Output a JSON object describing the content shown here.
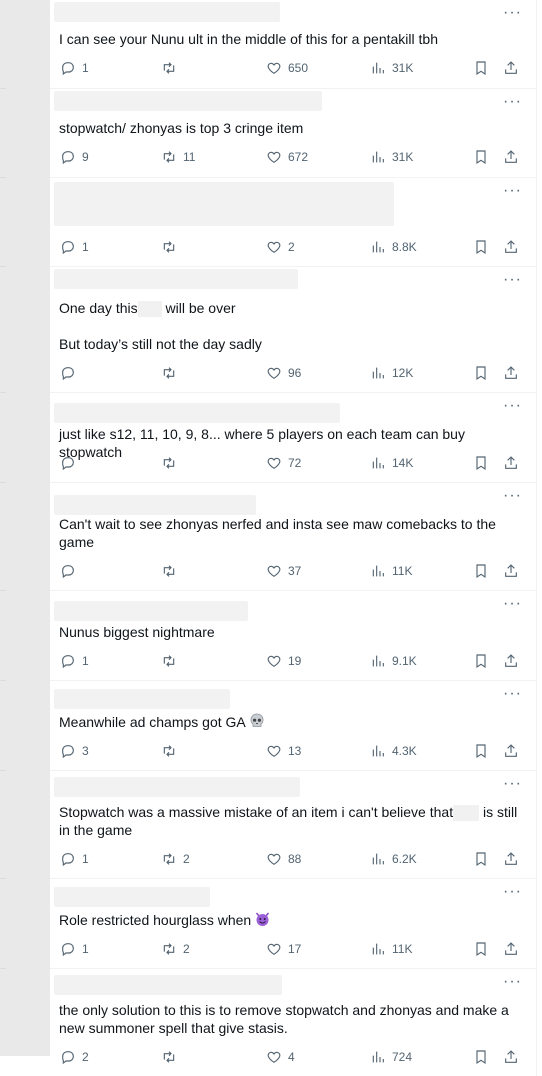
{
  "tweets": [
    {
      "text": "I can see your Nunu ult in the middle of this for a pentakill tbh",
      "replies": "1",
      "retweets": "",
      "likes": "650",
      "views": "31K"
    },
    {
      "text": "stopwatch/ zhonyas is top 3 cringe item",
      "replies": "9",
      "retweets": "11",
      "likes": "672",
      "views": "31K"
    },
    {
      "text": "",
      "replies": "1",
      "retweets": "",
      "likes": "2",
      "views": "8.8K"
    },
    {
      "text_a": "One day this",
      "text_b": " will be over",
      "text2": "But today’s still not the day sadly",
      "replies": "",
      "retweets": "",
      "likes": "96",
      "views": "12K"
    },
    {
      "text": "just like s12, 11, 10, 9, 8... where 5 players on each team can buy stopwatch",
      "replies": "",
      "retweets": "",
      "likes": "72",
      "views": "14K"
    },
    {
      "text": "Can't wait to see zhonyas nerfed and insta see maw comebacks to the game",
      "replies": "",
      "retweets": "",
      "likes": "37",
      "views": "11K"
    },
    {
      "text": "Nunus biggest nightmare",
      "replies": "1",
      "retweets": "",
      "likes": "19",
      "views": "9.1K"
    },
    {
      "text": "Meanwhile ad champs got GA",
      "emoji": "skull-emoji",
      "replies": "3",
      "retweets": "",
      "likes": "13",
      "views": "4.3K"
    },
    {
      "text_a": "Stopwatch was a massive mistake of an item i can't believe that",
      "text_b": " is still in the game",
      "replies": "1",
      "retweets": "2",
      "likes": "88",
      "views": "6.2K"
    },
    {
      "text": "Role restricted hourglass when",
      "emoji": "smiling-devil-emoji",
      "replies": "1",
      "retweets": "2",
      "likes": "17",
      "views": "11K"
    },
    {
      "text": "the only solution to this is to remove stopwatch and zhonyas and make a new summoner spell that give stasis.",
      "replies": "2",
      "retweets": "",
      "likes": "4",
      "views": "724"
    }
  ],
  "more_label": "···",
  "icons": {
    "reply": "reply-icon",
    "retweet": "retweet-icon",
    "like": "heart-icon",
    "views": "views-icon",
    "bookmark": "bookmark-icon",
    "share": "share-icon"
  }
}
